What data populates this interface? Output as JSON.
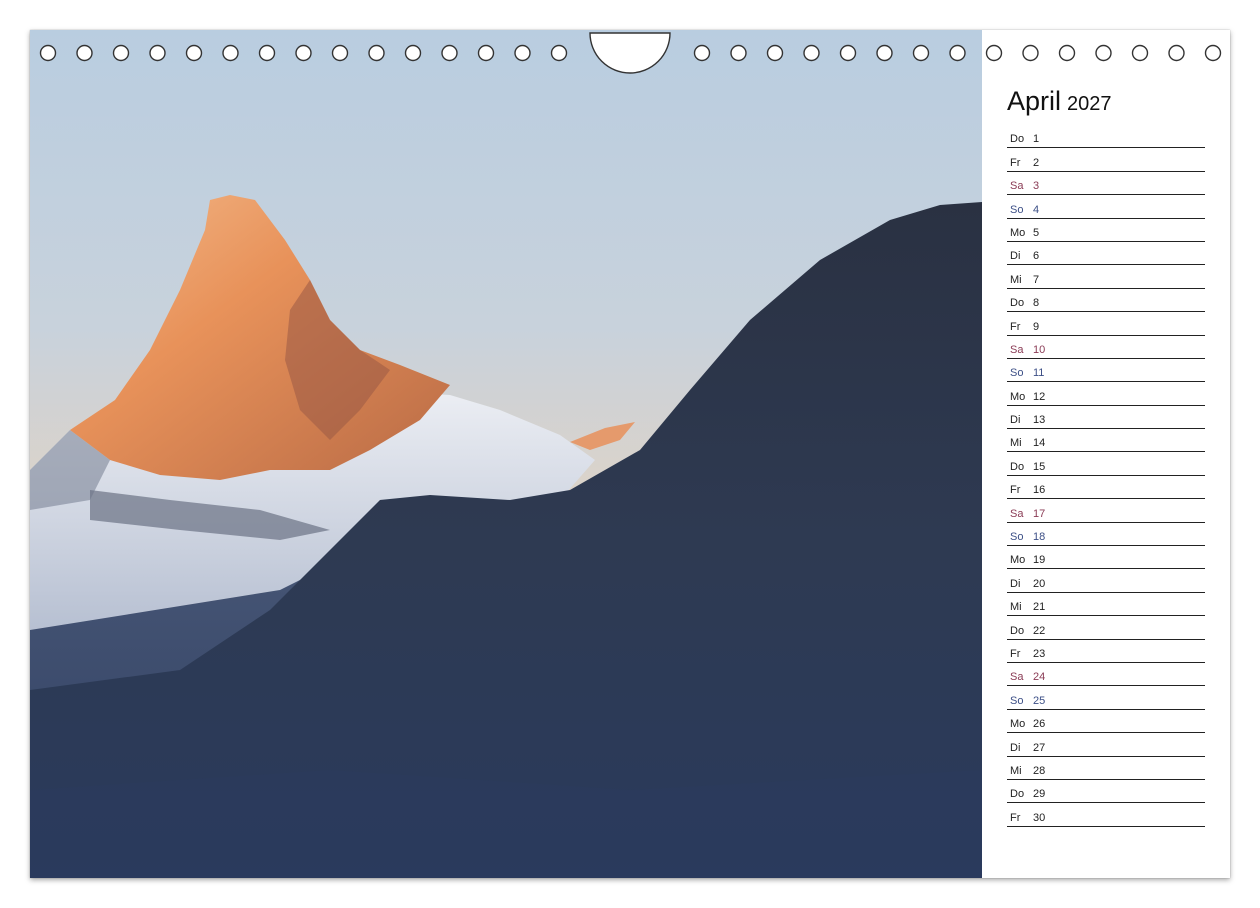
{
  "calendar": {
    "month": "April",
    "year": "2027",
    "days": [
      {
        "weekday": "Do",
        "day": "1"
      },
      {
        "weekday": "Fr",
        "day": "2"
      },
      {
        "weekday": "Sa",
        "day": "3"
      },
      {
        "weekday": "So",
        "day": "4"
      },
      {
        "weekday": "Mo",
        "day": "5"
      },
      {
        "weekday": "Di",
        "day": "6"
      },
      {
        "weekday": "Mi",
        "day": "7"
      },
      {
        "weekday": "Do",
        "day": "8"
      },
      {
        "weekday": "Fr",
        "day": "9"
      },
      {
        "weekday": "Sa",
        "day": "10"
      },
      {
        "weekday": "So",
        "day": "11"
      },
      {
        "weekday": "Mo",
        "day": "12"
      },
      {
        "weekday": "Di",
        "day": "13"
      },
      {
        "weekday": "Mi",
        "day": "14"
      },
      {
        "weekday": "Do",
        "day": "15"
      },
      {
        "weekday": "Fr",
        "day": "16"
      },
      {
        "weekday": "Sa",
        "day": "17"
      },
      {
        "weekday": "So",
        "day": "18"
      },
      {
        "weekday": "Mo",
        "day": "19"
      },
      {
        "weekday": "Di",
        "day": "20"
      },
      {
        "weekday": "Mi",
        "day": "21"
      },
      {
        "weekday": "Do",
        "day": "22"
      },
      {
        "weekday": "Fr",
        "day": "23"
      },
      {
        "weekday": "Sa",
        "day": "24"
      },
      {
        "weekday": "So",
        "day": "25"
      },
      {
        "weekday": "Mo",
        "day": "26"
      },
      {
        "weekday": "Di",
        "day": "27"
      },
      {
        "weekday": "Mi",
        "day": "28"
      },
      {
        "weekday": "Do",
        "day": "29"
      },
      {
        "weekday": "Fr",
        "day": "30"
      }
    ]
  },
  "colors": {
    "saturday_text": "#8a3b55",
    "sunday_text": "#3c4f86",
    "sky_top": "#b9cde0",
    "peak_glow": "#e8925a",
    "mountain_shadow": "#2e3a52"
  },
  "photo": {
    "icon": "mountain-photo"
  }
}
